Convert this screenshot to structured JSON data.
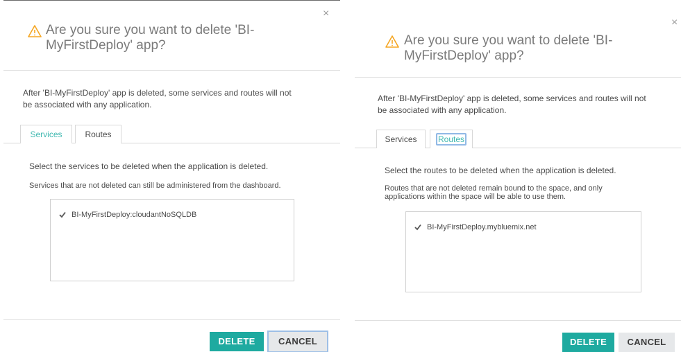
{
  "left": {
    "title_line1": "Are you sure you want to delete 'BI-",
    "title_line2": "MyFirstDeploy' app?",
    "close": "×",
    "desc_line1": "After 'BI-MyFirstDeploy' app is deleted, some services and routes will not",
    "desc_line2": "be associated with any application.",
    "tabs": [
      {
        "label": "Services"
      },
      {
        "label": "Routes"
      }
    ],
    "instruction": "Select the services to be deleted when the application is deleted.",
    "note_line1": "Services that are not deleted can still be administered from the dashboard.",
    "note_line2": "",
    "item": "BI-MyFirstDeploy:cloudantNoSQLDB",
    "delete_label": "DELETE",
    "cancel_label": "CANCEL"
  },
  "right": {
    "title_line1": "Are you sure you want to delete 'BI-",
    "title_line2": "MyFirstDeploy' app?",
    "close": "×",
    "desc_line1": "After 'BI-MyFirstDeploy' app is deleted, some services and routes will not",
    "desc_line2": "be associated with any application.",
    "tabs": [
      {
        "label": "Services"
      },
      {
        "label": "Routes"
      }
    ],
    "instruction": "Select the routes to be deleted when the application is deleted.",
    "note_line1": "Routes that are not deleted remain bound to the space, and only",
    "note_line2": "applications within the space will be able to use them.",
    "item": "BI-MyFirstDeploy.mybluemix.net",
    "delete_label": "DELETE",
    "cancel_label": "CANCEL"
  },
  "colors": {
    "accent": "#1eaaa0",
    "warning": "#f5a623",
    "active_tab": "#3fb8b0"
  }
}
